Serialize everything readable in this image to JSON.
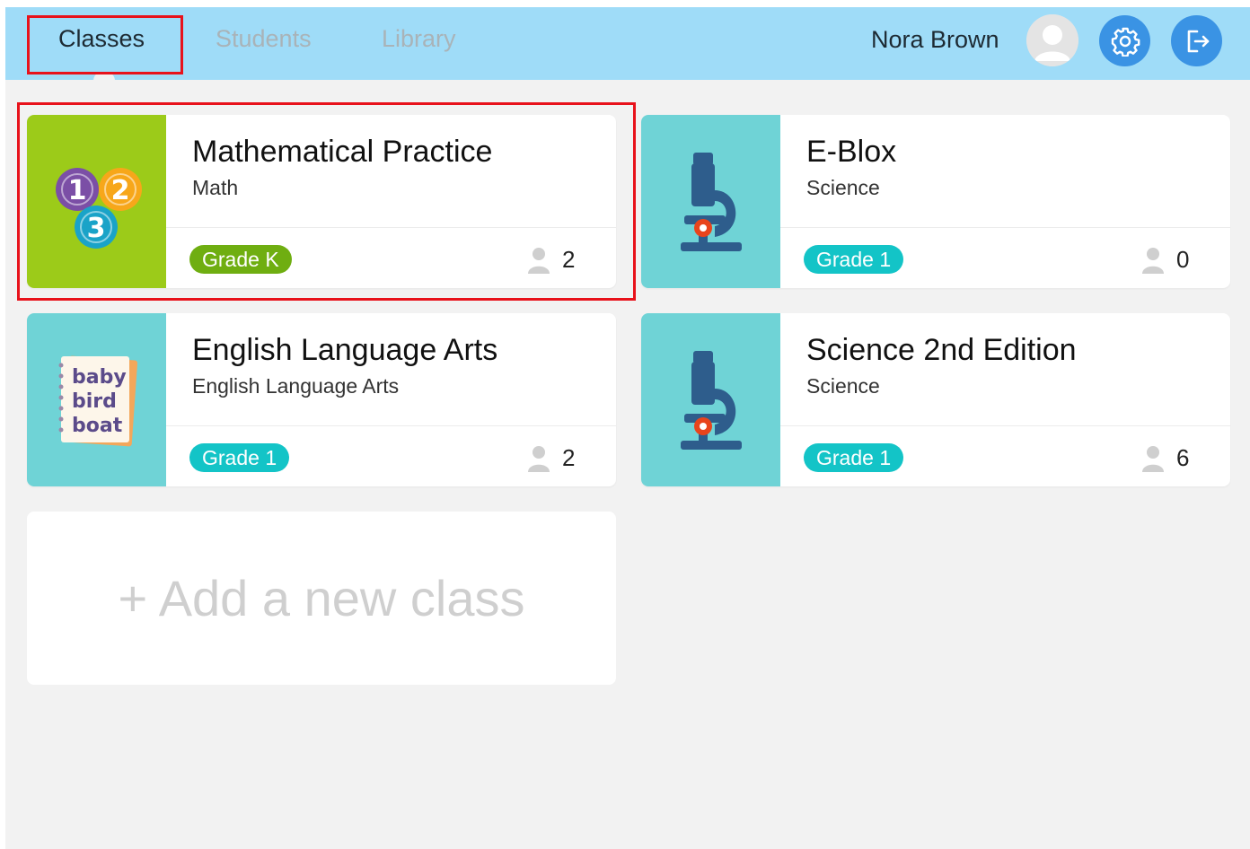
{
  "nav": {
    "tabs": [
      {
        "label": "Classes",
        "active": true
      },
      {
        "label": "Students",
        "active": false
      },
      {
        "label": "Library",
        "active": false
      }
    ]
  },
  "user": {
    "name": "Nora Brown",
    "avatar_icon": "user-avatar-icon",
    "settings_icon": "gear-icon",
    "logout_icon": "logout-icon"
  },
  "classes": [
    {
      "title": "Mathematical Practice",
      "subject": "Math",
      "grade": "Grade K",
      "students": "2",
      "thumb_color": "#9ccb19",
      "badge_color": "#6fae11",
      "icon": "numbers-123-icon"
    },
    {
      "title": "E-Blox",
      "subject": "Science",
      "grade": "Grade 1",
      "students": "0",
      "thumb_color": "#6fd3d6",
      "badge_color": "#13c4c7",
      "icon": "microscope-icon"
    },
    {
      "title": "English Language Arts",
      "subject": "English Language Arts",
      "grade": "Grade 1",
      "students": "2",
      "thumb_color": "#6fd3d6",
      "badge_color": "#13c4c7",
      "icon": "notebook-icon",
      "thumb_text": [
        "baby",
        "bird",
        "boat"
      ]
    },
    {
      "title": "Science 2nd Edition",
      "subject": "Science",
      "grade": "Grade 1",
      "students": "6",
      "thumb_color": "#6fd3d6",
      "badge_color": "#13c4c7",
      "icon": "microscope-icon"
    }
  ],
  "add_class": {
    "label": "+ Add a new class"
  },
  "colors": {
    "topbar": "#9fdcf8",
    "button_blue": "#3a93e4",
    "highlight_red": "#e8121b",
    "background": "#f2f2f2"
  }
}
